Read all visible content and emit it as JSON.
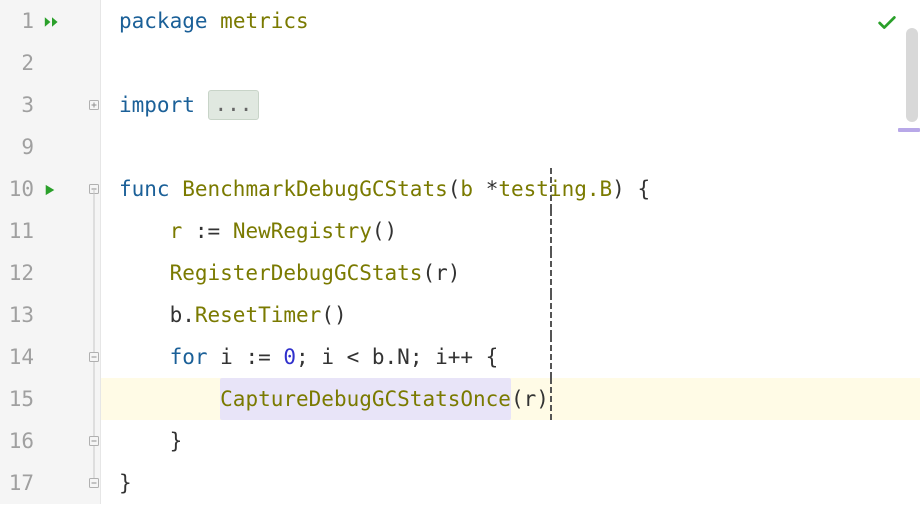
{
  "colors": {
    "keyword": "#1b6098",
    "identifier": "#7a7a00",
    "number": "#3030cc",
    "text": "#333333",
    "highlight_line": "#fffbe6",
    "highlight_box": "#e8e4f8",
    "gutter": "#f5f5f5",
    "ok_green": "#2aa02a"
  },
  "column_guide": 26,
  "status": "ok",
  "gutter": {
    "lines": [
      "1",
      "2",
      "3",
      "9",
      "10",
      "11",
      "12",
      "13",
      "14",
      "15",
      "16",
      "17"
    ]
  },
  "code": {
    "l0": {
      "package_kw": "package",
      "pkg_name": "metrics",
      "run_icon": "run-all"
    },
    "l1": "",
    "l2": {
      "import_kw": "import",
      "ellipsis": "...",
      "fold": "collapsed"
    },
    "l3": "",
    "l4": {
      "func_kw": "func",
      "fn_name": "BenchmarkDebugGCStats",
      "sig_open": "(",
      "param_name": "b",
      "star": " *",
      "param_type": "testing.B",
      "sig_close": ") {",
      "run_icon": "run"
    },
    "l5": {
      "indent": "    ",
      "r": "r",
      "assign": " := ",
      "call": "NewRegistry",
      "after": "()"
    },
    "l6": {
      "indent": "    ",
      "call": "RegisterDebugGCStats",
      "after": "(r)"
    },
    "l7": {
      "indent": "    ",
      "recv": "b.",
      "call": "ResetTimer",
      "after": "()"
    },
    "l8": {
      "indent": "    ",
      "for_kw": "for",
      "after_for": " i := ",
      "zero": "0",
      "mid": "; i < b.N; i++ {"
    },
    "l9": {
      "indent": "        ",
      "call": "CaptureDebugGCStatsOnce",
      "after": "(r)"
    },
    "l10": {
      "indent": "    ",
      "brace": "}"
    },
    "l11": {
      "brace": "}"
    }
  }
}
